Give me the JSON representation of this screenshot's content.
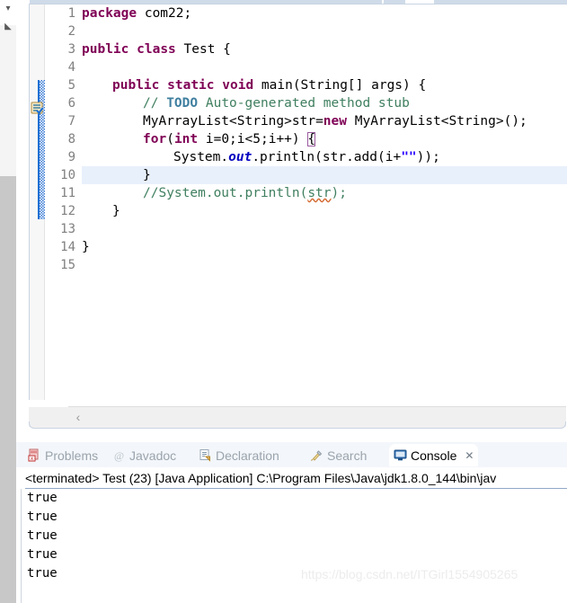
{
  "trim": {
    "glyph_top": "▾",
    "glyph_restore": "◣"
  },
  "editor": {
    "current_line": 10,
    "fold_line": 5,
    "fold_glyph": "⊖",
    "todo_marker_name": "todo-task-marker",
    "hscroll_left_arrow": "‹",
    "line_numbers": [
      1,
      2,
      3,
      4,
      5,
      6,
      7,
      8,
      9,
      10,
      11,
      12,
      13,
      14,
      15
    ],
    "lines": [
      {
        "n": 1,
        "text": "package com22;"
      },
      {
        "n": 2,
        "text": ""
      },
      {
        "n": 3,
        "text": "public class Test {"
      },
      {
        "n": 4,
        "text": ""
      },
      {
        "n": 5,
        "text": "    public static void main(String[] args) {"
      },
      {
        "n": 6,
        "text": "        // TODO Auto-generated method stub"
      },
      {
        "n": 7,
        "text": "        MyArrayList<String>str=new MyArrayList<String>();"
      },
      {
        "n": 8,
        "text": "        for(int i=0;i<5;i++) {"
      },
      {
        "n": 9,
        "text": "            System.out.println(str.add(i+\"\"));"
      },
      {
        "n": 10,
        "text": "        }"
      },
      {
        "n": 11,
        "text": "        //System.out.println(str);"
      },
      {
        "n": 12,
        "text": "    }"
      },
      {
        "n": 13,
        "text": ""
      },
      {
        "n": 14,
        "text": "}"
      },
      {
        "n": 15,
        "text": ""
      }
    ],
    "tokens": {
      "kw_package": "package",
      "pkg_name": " com22;",
      "kw_public": "public",
      "kw_class": "class",
      "class_name": " Test {",
      "kw_static": "static",
      "kw_void": "void",
      "main_sig": " main(String[] args) {",
      "comment_slashes": "// ",
      "comment_todo": "TODO",
      "comment_rest": " Auto-generated method stub",
      "decl_type": "MyArrayList<String>",
      "decl_var": "str=",
      "kw_new": "new",
      "decl_ctor": " MyArrayList<String>();",
      "kw_for": "for",
      "for_open": "(",
      "kw_int": "int",
      "for_rest": " i=0;i<5;i++) ",
      "for_brace": "{",
      "sys_prefix": "System.",
      "sys_out": "out",
      "sys_call": ".println(str.add(i+",
      "empty_string": "\"\"",
      "sys_tail": "));",
      "close_brace": "}",
      "commented_call_pre": "//System.out.println(",
      "commented_call_var": "str",
      "commented_call_post": ");"
    }
  },
  "console_view": {
    "tabs": [
      {
        "label": "Problems",
        "icon": "problems-icon",
        "active": false
      },
      {
        "label": "Javadoc",
        "icon": "javadoc-icon",
        "active": false
      },
      {
        "label": "Declaration",
        "icon": "declaration-icon",
        "active": false
      },
      {
        "label": "Search",
        "icon": "search-icon",
        "active": false
      },
      {
        "label": "Console",
        "icon": "console-icon",
        "active": true
      }
    ],
    "close_glyph": "✕",
    "launch_header": "<terminated> Test (23) [Java Application] C:\\Program Files\\Java\\jdk1.8.0_144\\bin\\jav",
    "output": [
      "true",
      "true",
      "true",
      "true",
      "true"
    ]
  },
  "watermark": {
    "text": "https://blog.csdn.net/ITGirl1554905265"
  },
  "colors": {
    "keyword": "#7f0055",
    "comment": "#3f7f5f",
    "todo_tag": "#3f7f9f",
    "string": "#2a00ff",
    "field": "#0000c0",
    "current_line": "#e8f0fb",
    "change_bar": "#1a6fd4"
  }
}
